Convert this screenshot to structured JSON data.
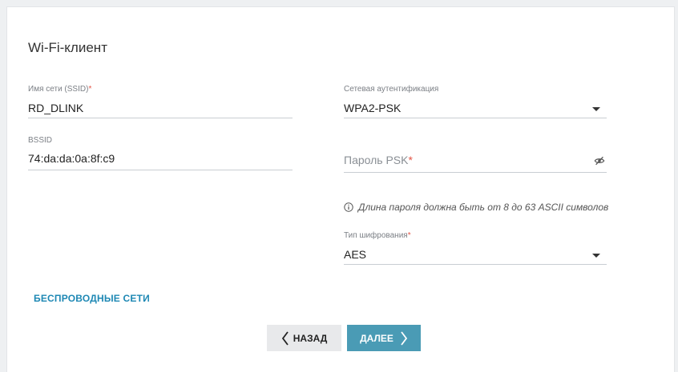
{
  "page": {
    "title": "Wi-Fi-клиент"
  },
  "fields": {
    "ssid": {
      "label": "Имя сети (SSID)",
      "required": "*",
      "value": "RD_DLINK"
    },
    "bssid": {
      "label": "BSSID",
      "value": "74:da:da:0a:8f:c9"
    },
    "auth": {
      "label": "Сетевая аутентификация",
      "value": "WPA2-PSK"
    },
    "psk": {
      "placeholder": "Пароль PSK",
      "required": "*"
    },
    "cipher": {
      "label": "Тип шифрования",
      "required": "*",
      "value": "AES"
    }
  },
  "hint": {
    "text": "Длина пароля должна быть от 8 до 63 ASCII символов"
  },
  "links": {
    "wireless_networks": "БЕСПРОВОДНЫЕ СЕТИ"
  },
  "buttons": {
    "back": "НАЗАД",
    "next": "ДАЛЕЕ"
  },
  "colors": {
    "accent": "#1e88b4",
    "primary_button": "#4a9bb5",
    "required": "#e45546"
  },
  "icons": {
    "psk_toggle": "eye-off-icon",
    "hint": "info-icon",
    "back": "chevron-left-icon",
    "next": "chevron-right-icon",
    "dropdown": "caret-down-icon"
  }
}
